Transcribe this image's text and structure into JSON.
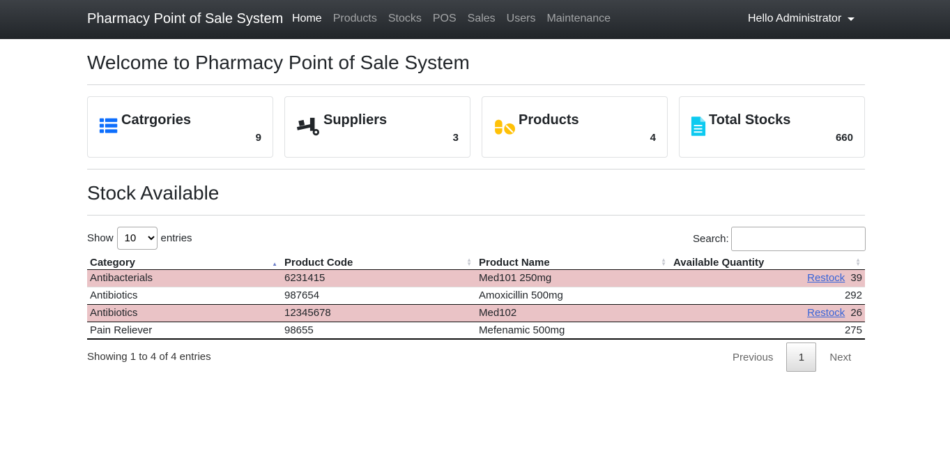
{
  "navbar": {
    "brand": "Pharmacy Point of Sale System",
    "links": [
      "Home",
      "Products",
      "Stocks",
      "POS",
      "Sales",
      "Users",
      "Maintenance"
    ],
    "user": "Hello Administrator"
  },
  "page_title": "Welcome to Pharmacy Point of Sale System",
  "cards": [
    {
      "title": "Catrgories",
      "value": "9",
      "icon": "list-icon",
      "color": "#0d6efd"
    },
    {
      "title": "Suppliers",
      "value": "3",
      "icon": "truck-loading-icon",
      "color": "#212529"
    },
    {
      "title": "Products",
      "value": "4",
      "icon": "pills-icon",
      "color": "#ffc107"
    },
    {
      "title": "Total Stocks",
      "value": "660",
      "icon": "file-icon",
      "color": "#0dcaf0"
    }
  ],
  "section_title": "Stock Available",
  "table_controls": {
    "show_label": "Show",
    "entries_label": "entries",
    "page_length": "10",
    "search_label": "Search:",
    "search_value": ""
  },
  "table": {
    "headers": [
      "Category",
      "Product Code",
      "Product Name",
      "Available Quantity"
    ],
    "rows": [
      {
        "category": "Antibacterials",
        "code": "6231415",
        "name": "Med101 250mg",
        "restock": "Restock",
        "qty": "39"
      },
      {
        "category": "Antibiotics",
        "code": "987654",
        "name": "Amoxicillin 500mg",
        "restock": "",
        "qty": "292"
      },
      {
        "category": "Antibiotics",
        "code": "12345678",
        "name": "Med102",
        "restock": "Restock",
        "qty": "26"
      },
      {
        "category": "Pain Reliever",
        "code": "98655",
        "name": "Mefenamic 500mg",
        "restock": "",
        "qty": "275"
      }
    ]
  },
  "footer": {
    "info": "Showing 1 to 4 of 4 entries",
    "previous": "Previous",
    "page": "1",
    "next": "Next"
  }
}
